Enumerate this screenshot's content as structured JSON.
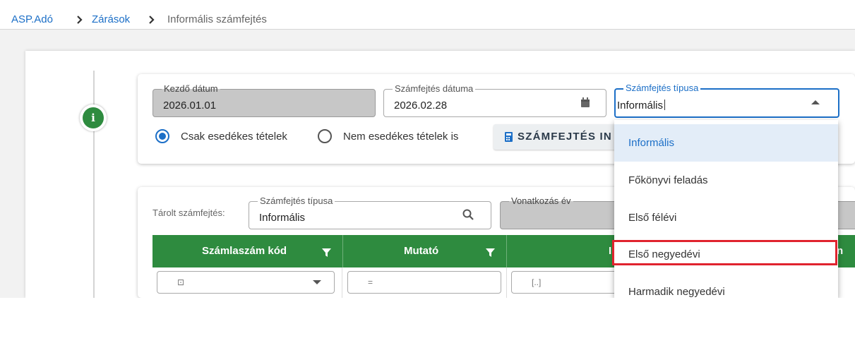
{
  "breadcrumb": {
    "items": [
      "ASP.Adó",
      "Zárások",
      "Informális számfejtés"
    ]
  },
  "calculation": {
    "start_date": {
      "label": "Kezdő dátum",
      "value": "2026.01.01"
    },
    "calc_date": {
      "label": "Számfejtés dátuma",
      "value": "2026.02.28",
      "icon": "calendar-icon"
    },
    "calc_type": {
      "label": "Számfejtés típusa",
      "value": "Informális",
      "icon": "chevron-up-icon"
    },
    "radios": [
      {
        "label": "Csak esedékes tételek",
        "selected": true
      },
      {
        "label": "Nem esedékes tételek is",
        "selected": false
      }
    ],
    "calc_button_label": "SZÁMFEJTÉS IN"
  },
  "stored": {
    "label": "Tárolt számfejtés:",
    "type_field": {
      "label": "Számfejtés típusa",
      "value": "Informális",
      "icon": "search-icon"
    },
    "year_field": {
      "label": "Vonatkozás év"
    }
  },
  "table": {
    "columns": [
      "Számlaszám kód",
      "Mutató",
      "I"
    ],
    "right_edge_text": "n",
    "filter_symbols": [
      "⊡",
      "=",
      "[..]"
    ]
  },
  "dropdown": {
    "options": [
      "Informális",
      "Főkönyvi feladás",
      "Első félévi",
      "Első negyedévi",
      "Harmadik negyedévi"
    ],
    "selected": "Informális",
    "highlighted": "Első negyedévi"
  },
  "colors": {
    "accent": "#1c6fc7",
    "header_green": "#2e8b3f",
    "highlight_red": "#e0232e"
  }
}
